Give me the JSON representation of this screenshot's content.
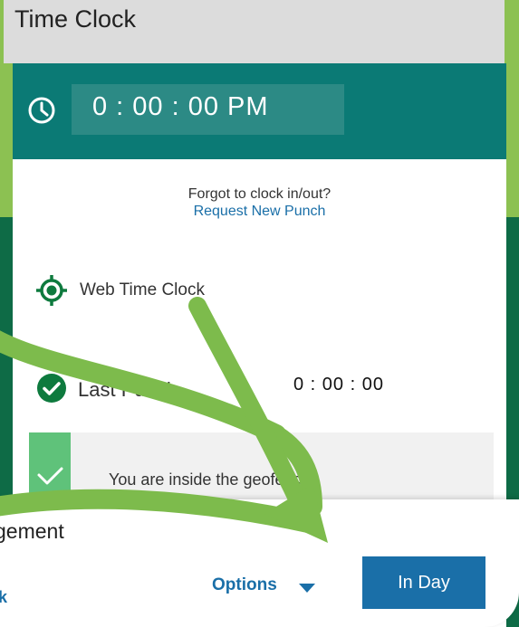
{
  "header": {
    "title": "Time Clock"
  },
  "clock": {
    "icon": "clock-icon",
    "time": "0 : 00 : 00 PM"
  },
  "punch_help": {
    "question": "Forgot to clock in/out?",
    "link": "Request New Punch"
  },
  "web_time_clock": {
    "icon": "target-icon",
    "label": "Web Time Clock"
  },
  "last_punch": {
    "icon": "check-circle-icon",
    "label": "Last Punch -",
    "time": "0 : 00 : 00"
  },
  "geofence": {
    "icon": "check-icon",
    "message": "You are inside the geofence."
  },
  "footer": {
    "title": "gement",
    "link": "k",
    "options_label": "Options",
    "in_day_label": "In Day"
  },
  "colors": {
    "light_green": "#8cc152",
    "dark_green": "#0e6b46",
    "teal": "#0b7a75",
    "link_blue": "#1a6fa8",
    "check_green": "#5fc27a",
    "arrow_green": "#7dbb4c"
  }
}
